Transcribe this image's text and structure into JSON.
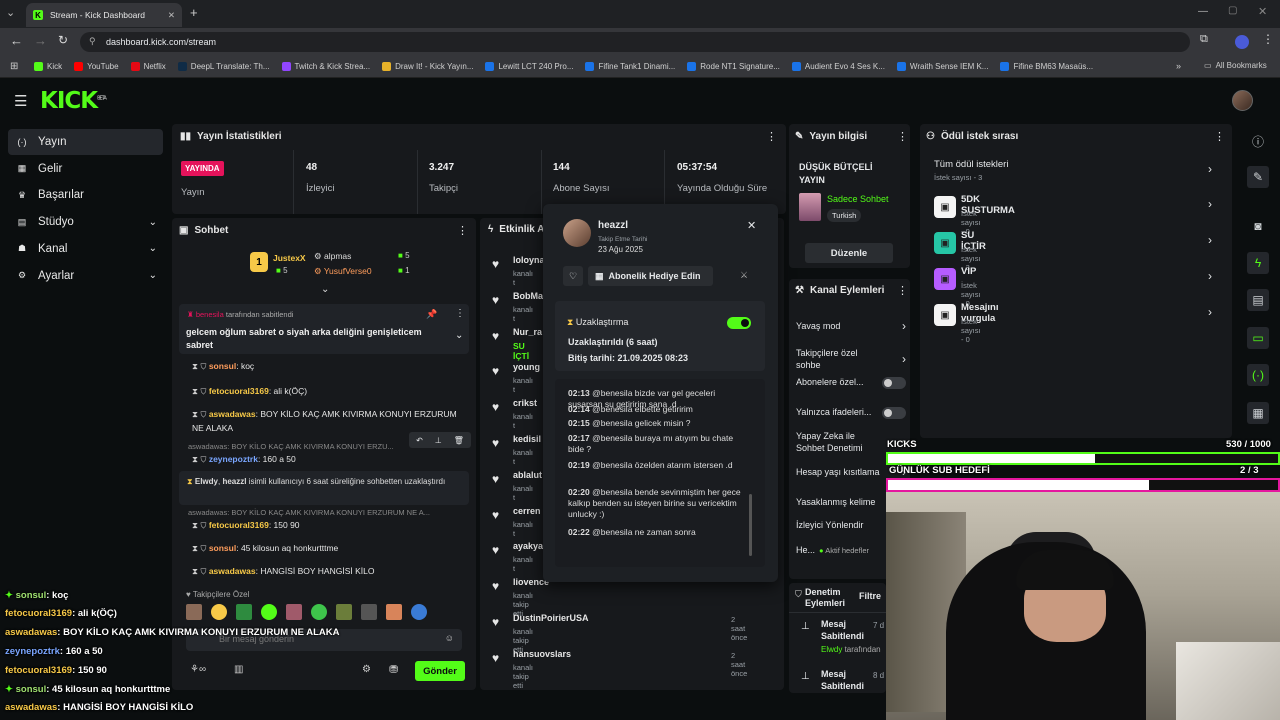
{
  "browser": {
    "tab_title": "Stream - Kick Dashboard",
    "url": "dashboard.kick.com/stream",
    "bookmarks": [
      "Kick",
      "YouTube",
      "Netflix",
      "DeepL Translate: Th...",
      "Twitch & Kick Strea...",
      "Draw It! - Kick Yayın...",
      "Lewitt LCT 240 Pro...",
      "Fifine Tank1 Dinami...",
      "Rode NT1 Signature...",
      "Audient Evo 4 Ses K...",
      "Wraith Sense IEM K...",
      "Fifine BM63 Masaüs..."
    ],
    "all_bookmarks": "All Bookmarks"
  },
  "app": {
    "logo": "KICK",
    "beta": "BETA"
  },
  "sidebar": {
    "items": [
      {
        "label": "Yayın",
        "icon": "(·)"
      },
      {
        "label": "Gelir",
        "icon": "▦"
      },
      {
        "label": "Başarılar",
        "icon": "♛"
      },
      {
        "label": "Stüdyo",
        "icon": "▤"
      },
      {
        "label": "Kanal",
        "icon": "☗"
      },
      {
        "label": "Ayarlar",
        "icon": "⚙"
      }
    ]
  },
  "stats": {
    "title": "Yayın İstatistikleri",
    "live_badge": "YAYINDA",
    "live_label": "Yayın",
    "viewers": {
      "value": "48",
      "label": "İzleyici"
    },
    "followers": {
      "value": "3.247",
      "label": "Takipçi"
    },
    "subs": {
      "value": "144",
      "label": "Abone Sayısı"
    },
    "duration": {
      "value": "05:37:54",
      "label": "Yayında Olduğu Süre"
    }
  },
  "chat": {
    "title": "Sohbet",
    "top_users": [
      {
        "name": "JustexX",
        "count": "5"
      },
      {
        "name": "alpmas",
        "count": "5"
      },
      {
        "name": "YusufVerse0",
        "count": "1"
      }
    ],
    "pinned_by": "benesila",
    "pinned_by_suffix": "tarafından sabitlendi",
    "pinned_text": "gelcem oğlum sabret o siyah arka deliğini genişleticem sabret",
    "messages": [
      {
        "user": "sonsul",
        "text": ": koç"
      },
      {
        "user": "fetocuoral3169",
        "text": ": ali k(ÖÇ)"
      },
      {
        "user": "aswadawas",
        "text": ": BOY KİLO KAÇ AMK KIVIRMA KONUYI ERZURUM NE ALAKA"
      },
      {
        "user": "zeynepoztrk",
        "text": ": 160 a 50"
      },
      {
        "user": "fetocuoral3169",
        "text": ": 150 90"
      },
      {
        "user": "sonsul",
        "text": ": 45 kilosun aq honkurtttme"
      },
      {
        "user": "aswadawas",
        "text": ": HANGİSİ BOY HANGİSİ KİLO"
      }
    ],
    "reply_preview_1": "aswadawas: BOY KİLO KAÇ AMK KIVIRMA KONUYI ERZU...",
    "reply_preview_2": "aswadawas: BOY KİLO KAÇ AMK KIVIRMA KONUYI ERZURUM NE A...",
    "mod_notice_user1": "Elwdy",
    "mod_notice_user2": "heazzl",
    "mod_notice_text": "isimli kullanıcıyı 6 saat süreliğine sohbetten uzaklaştırdı",
    "emote_label": "Takipçilere Özel",
    "input_placeholder": "Bir mesaj gönderin",
    "send": "Gönder"
  },
  "activity": {
    "title": "Etkinlik A",
    "items": [
      {
        "name": "loloyna",
        "sub": "kanalı t",
        "time": ""
      },
      {
        "name": "BobMa",
        "sub": "kanalı t",
        "time": ""
      },
      {
        "name": "Nur_ra",
        "sub": "SU İÇTİ",
        "time": ""
      },
      {
        "name": "young",
        "sub": "kanalı t",
        "time": ""
      },
      {
        "name": "crikst",
        "sub": "kanalı t",
        "time": ""
      },
      {
        "name": "kedisil",
        "sub": "kanalı t",
        "time": ""
      },
      {
        "name": "ablalut",
        "sub": "kanalı t",
        "time": ""
      },
      {
        "name": "cerren",
        "sub": "kanalı t",
        "time": ""
      },
      {
        "name": "ayakya",
        "sub": "kanalı t",
        "time": ""
      },
      {
        "name": "liovence",
        "sub": "kanalı takip etti",
        "time": ""
      },
      {
        "name": "DustinPoirierUSA",
        "sub": "kanalı takip etti",
        "time": "2 saat önce"
      },
      {
        "name": "hansuovslars",
        "sub": "kanalı takip etti",
        "time": "2 saat önce"
      }
    ]
  },
  "popup": {
    "username": "heazzl",
    "follow_date_label": "Takip Etme Tarihi",
    "follow_date": "23 Ağu 2025",
    "gift_button": "Abonelik Hediye Edin",
    "timeout_title": "Uzaklaştırma",
    "timeout_status": "Uzaklaştırıldı (6 saat)",
    "timeout_end": "Bitiş tarihi: 21.09.2025 08:23",
    "history": [
      {
        "time": "02:13",
        "text": "@benesila bizde var gel geceleri susarsan su getiririm sana .d"
      },
      {
        "time": "02:14",
        "text": "@benesila elbette getiririm"
      },
      {
        "time": "02:15",
        "text": "@benesila gelicek misin ?"
      },
      {
        "time": "02:17",
        "text": "@benesila buraya mı atıyım bu chate bide ?"
      },
      {
        "time": "02:19",
        "text": "@benesila özelden atarım istersen .d"
      },
      {
        "time": "02:20",
        "text": "@benesila bende sevinmiştim her gece kalkıp benden su isteyen birine su vericektim unlucky :)"
      },
      {
        "time": "02:22",
        "text": "@benesila ne zaman sonra"
      }
    ]
  },
  "stream_info": {
    "title": "Yayın bilgisi",
    "stream_title": "DÜŞÜK BÜTÇELİ YAYIN",
    "category": "Sadece Sohbet",
    "language": "Turkish",
    "edit": "Düzenle"
  },
  "channel_actions": {
    "title": "Kanal Eylemleri",
    "items": [
      {
        "label": "Yavaş mod",
        "type": "arrow"
      },
      {
        "label": "Takipçilere özel sohbe",
        "type": "arrow"
      },
      {
        "label": "Abonelere özel...",
        "type": "toggle"
      },
      {
        "label": "Yalnızca ifadeleri...",
        "type": "toggle"
      },
      {
        "label": "Yapay Zeka ile Sohbet Denetimi",
        "type": "arrow"
      },
      {
        "label": "Hesap yaşı kısıtlama",
        "type": "arrow"
      },
      {
        "label": "Yasaklanmış kelime",
        "type": "arrow"
      },
      {
        "label": "İzleyici Yönlendir",
        "type": "none"
      },
      {
        "label": "He...",
        "type": "status"
      }
    ],
    "status_text": "Aktif hedefler"
  },
  "mod_log": {
    "title": "Denetim Eylemleri",
    "filter": "Filtre",
    "items": [
      {
        "title": "Mesaj Sabitlendi",
        "by": "Elwdy",
        "suffix": "tarafından",
        "time": "7 d"
      },
      {
        "title": "Mesaj Sabitlendi",
        "by": "",
        "suffix": "",
        "time": "8 d"
      }
    ]
  },
  "rewards": {
    "title": "Ödül istek sırası",
    "all_label": "Tüm ödül istekleri",
    "all_count": "İstek sayısı - 3",
    "items": [
      {
        "name": "5DK SUSTURMA",
        "count": "İstek sayısı - 0",
        "color": "#f4f4f4"
      },
      {
        "name": "SU İÇTİR",
        "count": "İstek sayısı - 3",
        "color": "#26c6a6"
      },
      {
        "name": "VIP",
        "count": "İstek sayısı - 0",
        "color": "#b65cff"
      },
      {
        "name": "Mesajını vurgula",
        "count": "İstek sayısı - 0",
        "color": "#f4f4f4"
      }
    ]
  },
  "overlay": {
    "kicks_label": "KICKS",
    "kicks_value": "530",
    "kicks_goal": "/ 1000",
    "kicks_progress": 0.53,
    "sub_label": "GÜNLÜK SUB HEDEFİ",
    "sub_value": "2",
    "sub_goal": "/ 3",
    "sub_progress": 0.67,
    "chat": [
      {
        "user": "sonsul",
        "text": ": koç"
      },
      {
        "user": "fetocuoral3169",
        "text": ": ali k(ÖÇ)"
      },
      {
        "user": "aswadawas",
        "text": ": BOY KİLO KAÇ AMK KIVIRMA KONUYI ERZURUM NE ALAKA"
      },
      {
        "user": "zeynepoztrk",
        "text": ": 160 a 50"
      },
      {
        "user": "fetocuoral3169",
        "text": ": 150 90"
      },
      {
        "user": "sonsul",
        "text": ": 45 kilosun aq honkurtttme"
      },
      {
        "user": "aswadawas",
        "text": ": HANGİSİ BOY HANGİSİ KİLO"
      }
    ]
  },
  "colors": {
    "brand": "#53fc18",
    "live": "#e5135b",
    "sub_bar": "#e5179f"
  }
}
